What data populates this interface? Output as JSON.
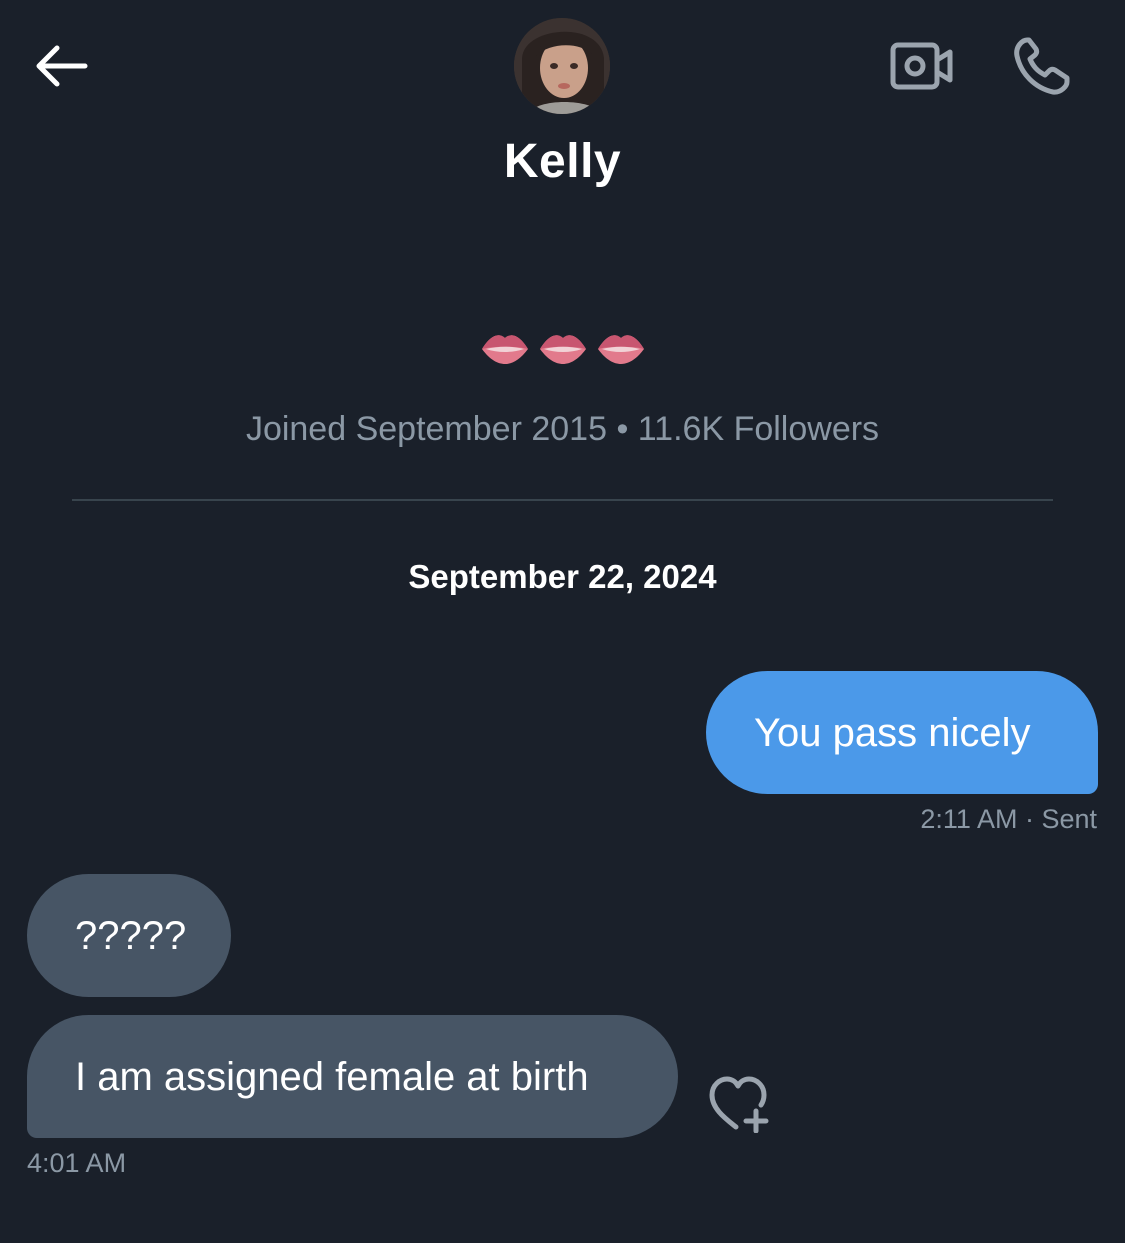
{
  "header": {
    "contact_name": "Kelly",
    "icons": {
      "back": "back-arrow-icon",
      "video": "video-camera-icon",
      "call": "phone-icon"
    }
  },
  "profile": {
    "bio": "👄👄👄",
    "joined": "Joined September 2015",
    "separator": "•",
    "followers": "11.6K Followers",
    "meta_line": "Joined September 2015 • 11.6K Followers"
  },
  "conversation": {
    "date": "September 22, 2024",
    "messages": [
      {
        "direction": "outgoing",
        "text": "You pass nicely",
        "time": "2:11 AM",
        "status": "Sent",
        "meta": "2:11 AM · Sent"
      },
      {
        "direction": "incoming",
        "text": "?????"
      },
      {
        "direction": "incoming",
        "text": "I am assigned female at birth",
        "time": "4:01 AM"
      }
    ],
    "reaction_icon": "heart-plus-icon"
  },
  "colors": {
    "background": "#1a202a",
    "outgoing_bubble": "#4b99e9",
    "incoming_bubble": "#475565",
    "secondary_text": "#8b98a5",
    "icon_gray": "#9ba4ae",
    "divider": "#38444d"
  }
}
